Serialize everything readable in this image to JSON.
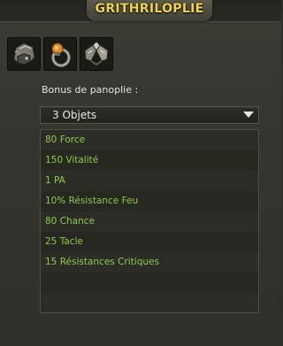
{
  "panel": {
    "title": "GRITHRILOPLIE",
    "bonus_label": "Bonus de panoplie :"
  },
  "items": [
    {
      "icon": "headgear-icon"
    },
    {
      "icon": "amulet-icon"
    },
    {
      "icon": "shoulder-armor-icon"
    }
  ],
  "bonus_select": {
    "value": "3 Objets"
  },
  "bonuses": [
    "80 Force",
    "150 Vitalité",
    "1 PA",
    "10% Résistance Feu",
    "80 Chance",
    "25 Tacle",
    "15 Résistances Critiques"
  ],
  "colors": {
    "title": "#f2d24b",
    "bonus_text": "#8ec94a",
    "panel_bg": "#2f302a"
  }
}
